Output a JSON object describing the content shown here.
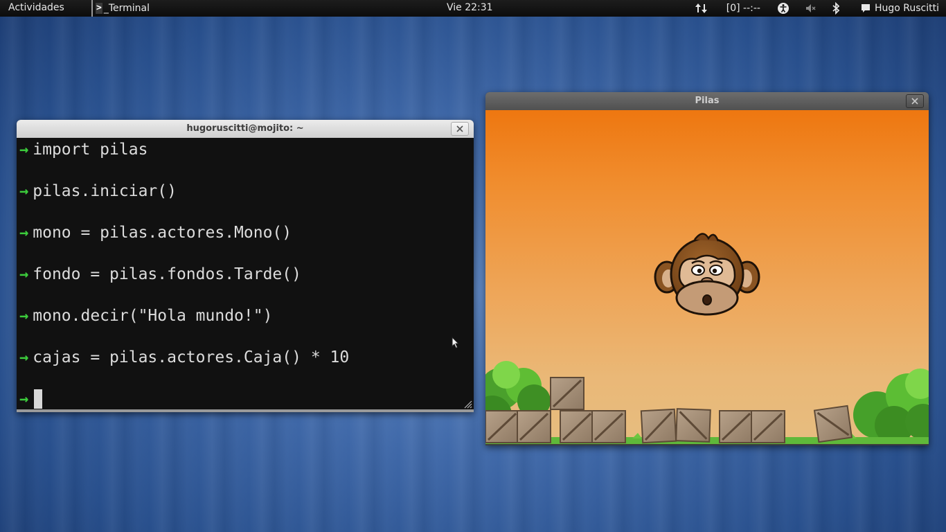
{
  "topbar": {
    "activities": "Actividades",
    "app_name": "_Terminal",
    "app_glyph": ">",
    "clock": "Vie 22:31",
    "battery": "[0] --:--",
    "user": "Hugo Ruscitti"
  },
  "terminal": {
    "title": "hugoruscitti@mojito: ~",
    "lines": [
      "import pilas",
      "pilas.iniciar()",
      "mono = pilas.actores.Mono()",
      "fondo = pilas.fondos.Tarde()",
      "mono.decir(\"Hola mundo!\")",
      "cajas = pilas.actores.Caja() * 10"
    ],
    "prompt": "→"
  },
  "pilas_window": {
    "title": "Pilas"
  },
  "icons": {
    "network": "network-transfer-icon",
    "accessibility": "accessibility-icon",
    "volume": "volume-muted-icon",
    "bluetooth": "bluetooth-icon",
    "chat": "chat-bubble-icon",
    "close": "close-icon"
  },
  "colors": {
    "prompt": "#3ccc3c",
    "sky_top": "#ee7710",
    "sky_bottom": "#e6bd80",
    "panel": "#0c0c0c"
  }
}
